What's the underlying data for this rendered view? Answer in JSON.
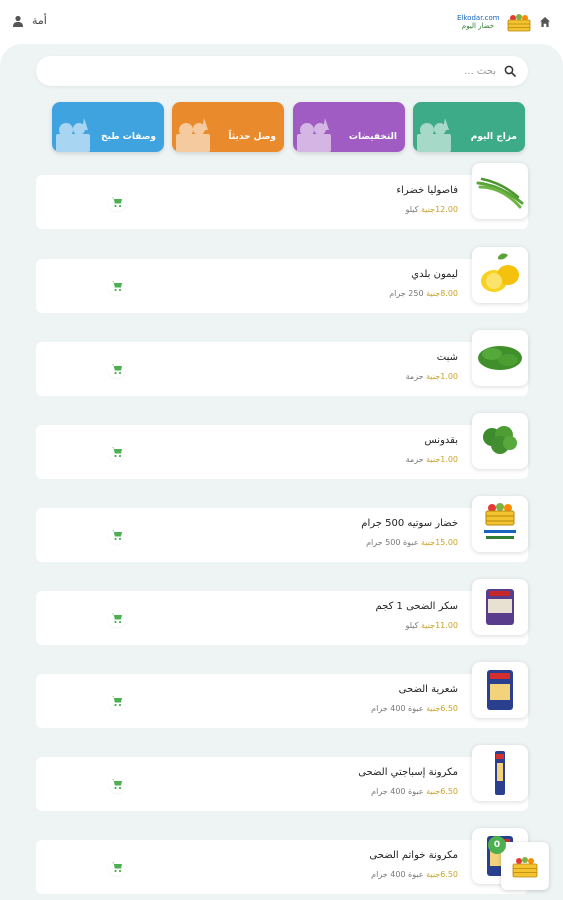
{
  "header": {
    "user_name": "أمة",
    "logo_line1": "Elkodar.com",
    "logo_line2": "خضار اليوم"
  },
  "search": {
    "placeholder": "بحث ..."
  },
  "categories": [
    {
      "label": "مزاج اليوم",
      "color": "#3dab87"
    },
    {
      "label": "التخفيضات",
      "color": "#a05cc2"
    },
    {
      "label": "وصل حديثاً",
      "color": "#e98b2c"
    },
    {
      "label": "وصفات طبخ",
      "color": "#3ea3df"
    }
  ],
  "products": [
    {
      "name": "فاصوليا خضراء",
      "price": "12.00",
      "currency": "جنية",
      "unit": "كيلو",
      "image": "green-beans"
    },
    {
      "name": "ليمون بلدي",
      "price": "8.00",
      "currency": "جنية",
      "unit": "250 جرام",
      "image": "lemon"
    },
    {
      "name": "شبت",
      "price": "1.00",
      "currency": "جنية",
      "unit": "حزمة",
      "image": "dill"
    },
    {
      "name": "بقدونس",
      "price": "1.00",
      "currency": "جنية",
      "unit": "حزمة",
      "image": "parsley"
    },
    {
      "name": "خضار سوتيه 500 جرام",
      "price": "15.00",
      "currency": "جنية",
      "unit": "عبوة 500 جرام",
      "image": "logo-placeholder"
    },
    {
      "name": "سكر الضحى 1 كجم",
      "price": "11.00",
      "currency": "جنية",
      "unit": "كيلو",
      "image": "sugar-bag"
    },
    {
      "name": "شعرية الضحى",
      "price": "6.50",
      "currency": "جنية",
      "unit": "عبوة 400 جرام",
      "image": "vermicelli-bag"
    },
    {
      "name": "مكرونة إسباجتي الضحى",
      "price": "6.50",
      "currency": "جنية",
      "unit": "عبوة 400 جرام",
      "image": "spaghetti-pack"
    },
    {
      "name": "مكرونة خواتم الضحى",
      "price": "6.50",
      "currency": "جنية",
      "unit": "عبوة 400 جرام",
      "image": "pasta-rings-pack"
    }
  ],
  "cart": {
    "count": "0",
    "accent": "#4caf50"
  },
  "colors": {
    "cart_icon": "#4caf50",
    "price": "#c9a227",
    "background": "#eef3f4"
  }
}
